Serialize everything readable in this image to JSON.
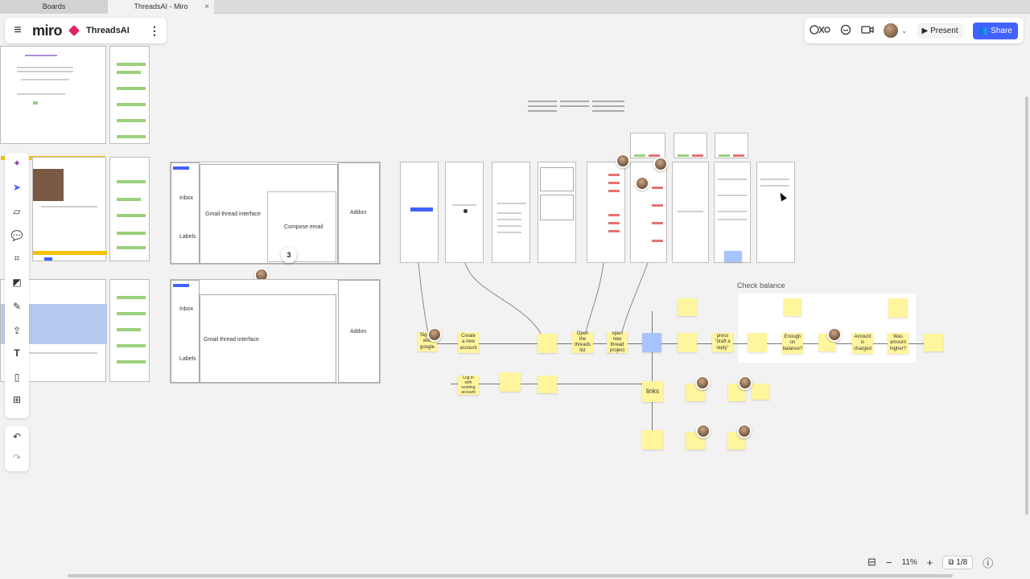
{
  "browser": {
    "tabs": [
      {
        "label": "Boards"
      },
      {
        "label": "ThreadsAI - Miro",
        "close": "×"
      }
    ]
  },
  "brand": {
    "menu_icon": "≡",
    "logo": "miro",
    "board_name": "ThreadsAI",
    "more_icon": "⋮"
  },
  "topright": {
    "reactions_icon": "reactions-icon",
    "comments_icon": "chat-icon",
    "video_icon": "video-icon",
    "present_label": "Present",
    "share_label": "Share",
    "accent": "#4262ff"
  },
  "toolbar": {
    "tools": [
      "ai-sparkle-icon",
      "select-icon",
      "sticky-note-icon",
      "comment-icon",
      "frame-icon",
      "shapes-icon",
      "pen-icon",
      "upload-icon",
      "text-icon",
      "template-icon",
      "add-icon"
    ],
    "undo_icon": "undo-icon",
    "redo_icon": "redo-icon"
  },
  "zoom": {
    "value": "11%",
    "pages": "1/8"
  },
  "wireframes": {
    "frame1": {
      "inbox": "Inbox",
      "labels": "Labels",
      "thread": "Gmail thread interface",
      "compose": "Compose email",
      "addon": "Addon"
    },
    "frame2": {
      "inbox": "Inbox",
      "labels": "Labels",
      "thread": "Gmail thread interface",
      "addon": "Addon"
    },
    "badge": "3"
  },
  "flow": {
    "section_title": "Check balance",
    "links_label": "links",
    "stickies": [
      {
        "text": "Sign in with google"
      },
      {
        "text": "Create a new account"
      },
      {
        "text": "Log in with existing account"
      },
      {
        "text": "Open the threads list"
      },
      {
        "text": "open new thread project"
      },
      {
        "text": "Enough on balance?"
      },
      {
        "text": "Amount is charged"
      },
      {
        "text": "Was amount higher?"
      },
      {
        "text": "press \"draft a reply\""
      }
    ]
  }
}
